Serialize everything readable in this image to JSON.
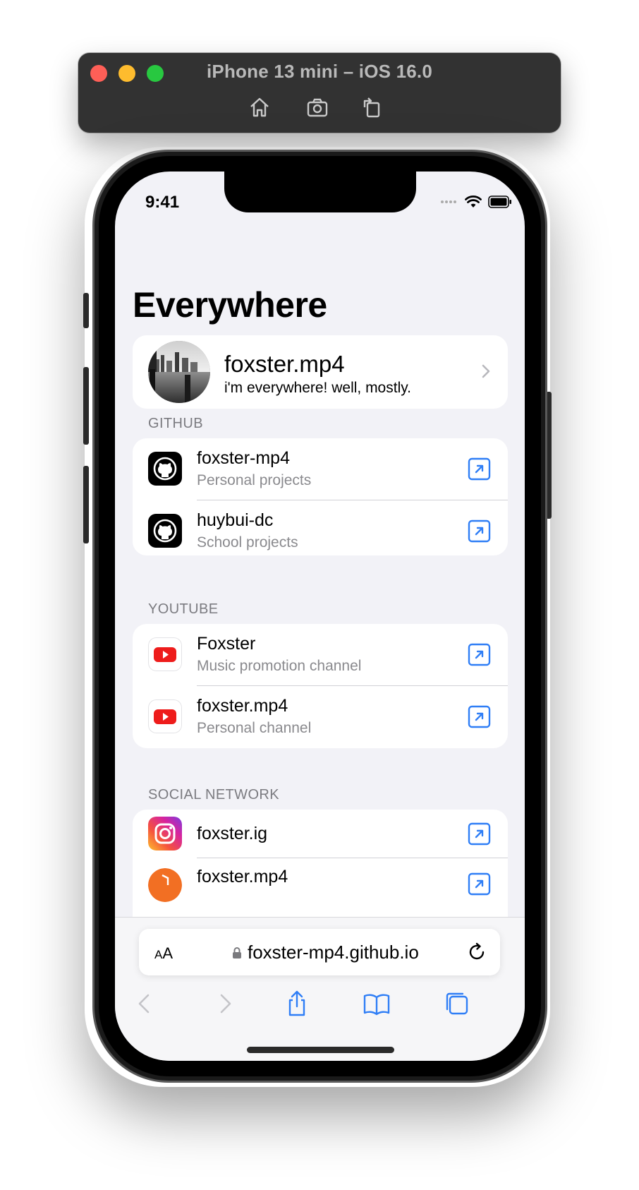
{
  "simulator": {
    "title": "iPhone 13 mini – iOS 16.0",
    "tools": [
      "home-icon",
      "screenshot-icon",
      "rotate-icon"
    ]
  },
  "status_bar": {
    "time": "9:41"
  },
  "page": {
    "title": "Everywhere"
  },
  "profile": {
    "name": "foxster.mp4",
    "bio": "i'm everywhere! well, mostly."
  },
  "sections": {
    "github": {
      "label": "GITHUB",
      "items": [
        {
          "title": "foxster-mp4",
          "subtitle": "Personal projects",
          "icon": "github-icon"
        },
        {
          "title": "huybui-dc",
          "subtitle": "School projects",
          "icon": "github-icon"
        }
      ]
    },
    "youtube": {
      "label": "YOUTUBE",
      "items": [
        {
          "title": "Foxster",
          "subtitle": "Music promotion channel",
          "icon": "youtube-icon"
        },
        {
          "title": "foxster.mp4",
          "subtitle": "Personal channel",
          "icon": "youtube-icon"
        }
      ]
    },
    "social": {
      "label": "SOCIAL NETWORK",
      "items": [
        {
          "title": "foxster.ig",
          "icon": "instagram-icon"
        },
        {
          "title": "foxster.mp4",
          "icon": "soundcloud-icon"
        }
      ]
    }
  },
  "browser": {
    "text_size_label_small": "A",
    "text_size_label_large": "A",
    "url": "foxster-mp4.github.io",
    "toolbar": [
      "back-icon",
      "forward-icon",
      "share-icon",
      "bookmarks-icon",
      "tabs-icon"
    ]
  },
  "colors": {
    "accent": "#2f7ef6",
    "background": "#f2f2f7",
    "youtube": "#ee1c1b"
  }
}
